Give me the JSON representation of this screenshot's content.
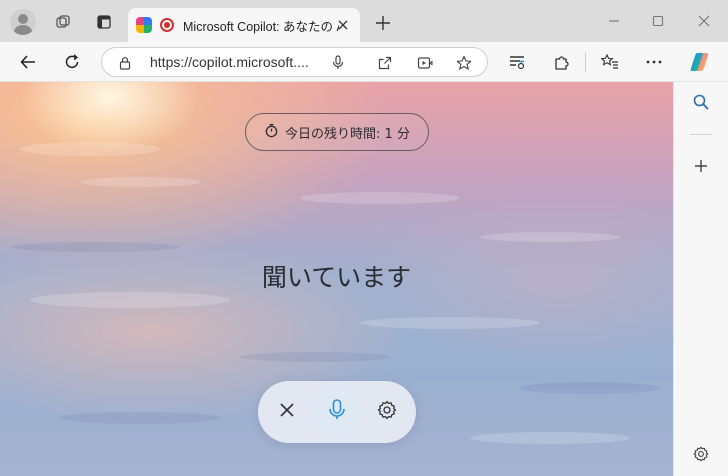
{
  "browser": {
    "tab": {
      "title": "Microsoft Copilot: あなたの AI"
    },
    "address": {
      "url": "https://copilot.microsoft...."
    }
  },
  "icons": [
    "profile-icon",
    "workspaces-icon",
    "tab-actions-icon",
    "copilot-favicon",
    "recording-icon",
    "close-tab-icon",
    "new-tab-icon",
    "minimize-icon",
    "maximize-icon",
    "close-window-icon",
    "back-icon",
    "refresh-icon",
    "lock-icon",
    "microphone-icon",
    "open-app-icon",
    "video-icon",
    "favorite-star-icon",
    "reading-icon",
    "extensions-icon",
    "collections-icon",
    "more-icon",
    "copilot-icon",
    "search-icon",
    "add-icon",
    "settings-icon"
  ],
  "copilot": {
    "timer_label": "今日の残り時間: 1 分",
    "status_text": "聞いています"
  },
  "colors": {
    "accent": "#2b8fd6",
    "record": "#d32f2f"
  }
}
